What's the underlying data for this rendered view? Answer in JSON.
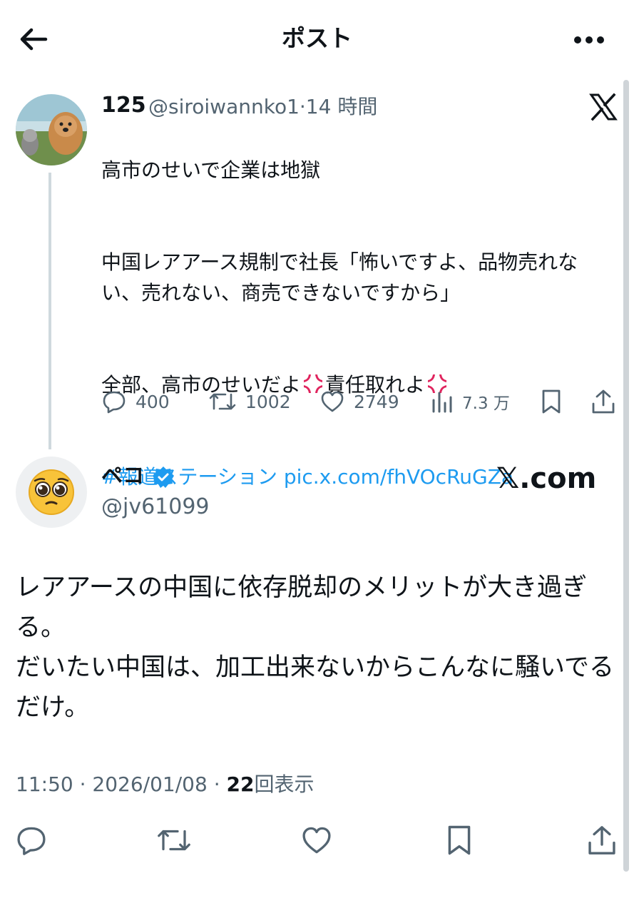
{
  "header": {
    "title": "ポスト",
    "back_icon": "arrow-left-icon",
    "more_icon": "more-dots-icon"
  },
  "quoted_tweet": {
    "display_name": "125",
    "handle": "@siroiwannko1",
    "separator": "·",
    "time": "14 時間",
    "body": {
      "line1": "高市のせいで企業は地獄",
      "paragraph2": "中国レアアース規制で社長「怖いですよ、品物売れない、売れない、商売できないですから」",
      "p3_part1": "全部、高市のせいだよ",
      "p3_part2": "責任取れよ",
      "hashtag": "#報道ステーション",
      "link": "pic.x.com/fhVOcRuGZa"
    },
    "actions": {
      "replies": "400",
      "reposts": "1002",
      "likes": "2749",
      "views": "7.3 万"
    },
    "brand_icon": "x-logo-icon"
  },
  "main_tweet": {
    "display_name": "ペコ",
    "handle": "@jv61099",
    "brand": "𝕏.com",
    "body_line1": "レアアースの中国に依存脱却のメリットが大き過ぎる。",
    "body_line2": "だいたい中国は、加工出来ないからこんなに騒いでるだけ。",
    "time": "11:50",
    "date": "2026/01/08",
    "dot": "·",
    "views_count": "22",
    "views_label": "回表示"
  },
  "colors": {
    "link": "#1d9bf0",
    "secondary_text": "#536471",
    "angry_mark": "#e0245e",
    "verified": "#1d9bf0"
  }
}
